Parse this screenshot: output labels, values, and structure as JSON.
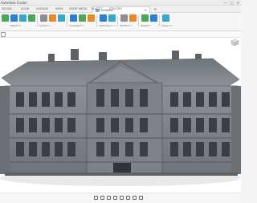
{
  "app": {
    "title": "Autodesk Fusion",
    "window_controls": [
      "—",
      "□",
      "✕"
    ]
  },
  "menus": [
    {
      "key": "design",
      "label": "DESIGN"
    },
    {
      "key": "solid",
      "label": "SOLID"
    },
    {
      "key": "surface",
      "label": "SURFACE"
    },
    {
      "key": "mesh",
      "label": "MESH"
    },
    {
      "key": "sheet",
      "label": "SHEET METAL"
    },
    {
      "key": "plastic",
      "label": "PLASTIC"
    },
    {
      "key": "utilities",
      "label": "UTILITIES"
    }
  ],
  "document_tab": {
    "name": "Untitled*"
  },
  "toolbar_groups": [
    {
      "key": "create",
      "label": "CREATE ▾"
    },
    {
      "key": "modify",
      "label": "MODIFY ▾"
    },
    {
      "key": "assemble",
      "label": "ASSEMBLE ▾"
    },
    {
      "key": "construct",
      "label": "CONSTRUCT ▾"
    },
    {
      "key": "inspect",
      "label": "INSPECT ▾"
    },
    {
      "key": "insert",
      "label": "INSERT ▾"
    },
    {
      "key": "select",
      "label": "SELECT ▾"
    }
  ],
  "icons": {
    "palette": {
      "blue": "#2d7fd3",
      "orange": "#e78a2c",
      "green": "#4fa35a",
      "gray": "#8e8e8e",
      "cyan": "#39a7c9"
    }
  }
}
